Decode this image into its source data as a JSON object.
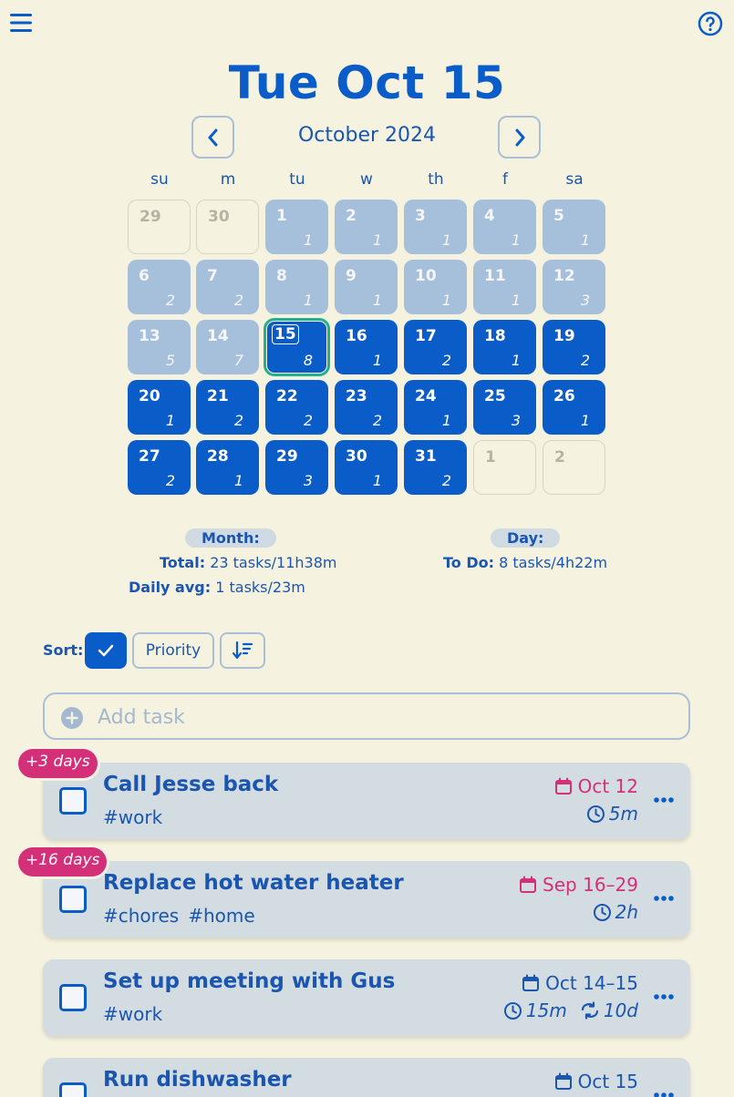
{
  "header": {
    "menu_icon": "hamburger-menu-icon",
    "help_icon": "help-circle-icon",
    "date_title": "Tue Oct 15",
    "month_label": "October 2024"
  },
  "calendar": {
    "weekdays": [
      "su",
      "m",
      "tu",
      "w",
      "th",
      "f",
      "sa"
    ],
    "weeks": [
      [
        {
          "day": "29",
          "count": "",
          "state": "out"
        },
        {
          "day": "30",
          "count": "",
          "state": "out"
        },
        {
          "day": "1",
          "count": "1",
          "state": "past"
        },
        {
          "day": "2",
          "count": "1",
          "state": "past"
        },
        {
          "day": "3",
          "count": "1",
          "state": "past"
        },
        {
          "day": "4",
          "count": "1",
          "state": "past"
        },
        {
          "day": "5",
          "count": "1",
          "state": "past"
        }
      ],
      [
        {
          "day": "6",
          "count": "2",
          "state": "past"
        },
        {
          "day": "7",
          "count": "2",
          "state": "past"
        },
        {
          "day": "8",
          "count": "1",
          "state": "past"
        },
        {
          "day": "9",
          "count": "1",
          "state": "past"
        },
        {
          "day": "10",
          "count": "1",
          "state": "past"
        },
        {
          "day": "11",
          "count": "1",
          "state": "past"
        },
        {
          "day": "12",
          "count": "3",
          "state": "past"
        }
      ],
      [
        {
          "day": "13",
          "count": "5",
          "state": "past"
        },
        {
          "day": "14",
          "count": "7",
          "state": "past"
        },
        {
          "day": "15",
          "count": "8",
          "state": "today"
        },
        {
          "day": "16",
          "count": "1",
          "state": "future"
        },
        {
          "day": "17",
          "count": "2",
          "state": "future"
        },
        {
          "day": "18",
          "count": "1",
          "state": "future"
        },
        {
          "day": "19",
          "count": "2",
          "state": "future"
        }
      ],
      [
        {
          "day": "20",
          "count": "1",
          "state": "future"
        },
        {
          "day": "21",
          "count": "2",
          "state": "future"
        },
        {
          "day": "22",
          "count": "2",
          "state": "future"
        },
        {
          "day": "23",
          "count": "2",
          "state": "future"
        },
        {
          "day": "24",
          "count": "1",
          "state": "future"
        },
        {
          "day": "25",
          "count": "3",
          "state": "future"
        },
        {
          "day": "26",
          "count": "1",
          "state": "future"
        }
      ],
      [
        {
          "day": "27",
          "count": "2",
          "state": "future"
        },
        {
          "day": "28",
          "count": "1",
          "state": "future"
        },
        {
          "day": "29",
          "count": "3",
          "state": "future"
        },
        {
          "day": "30",
          "count": "1",
          "state": "future"
        },
        {
          "day": "31",
          "count": "2",
          "state": "future"
        },
        {
          "day": "1",
          "count": "",
          "state": "out"
        },
        {
          "day": "2",
          "count": "",
          "state": "out"
        }
      ]
    ]
  },
  "stats": {
    "month_label": "Month:",
    "total_key": "Total:",
    "total_value": "23 tasks/11h38m",
    "avg_key": "Daily avg:",
    "avg_value": "1 tasks/23m",
    "day_label": "Day:",
    "todo_key": "To Do:",
    "todo_value": "8 tasks/4h22m"
  },
  "sort": {
    "label": "Sort:",
    "priority_label": "Priority"
  },
  "add_task": {
    "placeholder": "Add task"
  },
  "colors": {
    "accent": "#0a5cc8",
    "overdue": "#d42f79",
    "today_ring": "#24b08f",
    "background": "#f6f2e0"
  },
  "tasks": [
    {
      "title": "Call Jesse back",
      "tags": [
        "#work"
      ],
      "date": "Oct 12",
      "date_overdue": true,
      "duration": "5m",
      "repeat": "",
      "badge": "+3 days"
    },
    {
      "title": "Replace hot water heater",
      "tags": [
        "#chores",
        "#home"
      ],
      "date": "Sep 16–29",
      "date_overdue": true,
      "duration": "2h",
      "repeat": "",
      "badge": "+16 days"
    },
    {
      "title": "Set up meeting with Gus",
      "tags": [
        "#work"
      ],
      "date": "Oct 14–15",
      "date_overdue": false,
      "duration": "15m",
      "repeat": "10d",
      "badge": ""
    },
    {
      "title": "Run dishwasher",
      "tags": [],
      "date": "Oct 15",
      "date_overdue": false,
      "duration": "",
      "repeat": "",
      "badge": ""
    }
  ]
}
